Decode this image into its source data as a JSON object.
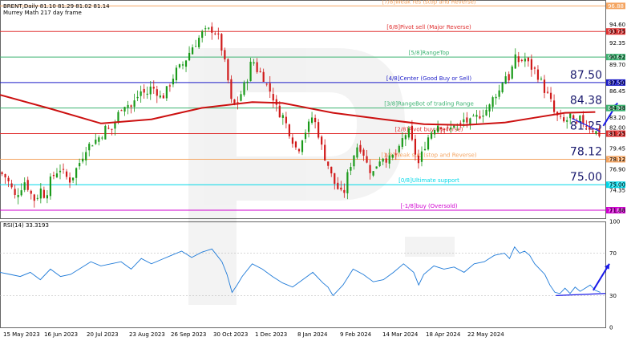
{
  "header": {
    "symbol_line": "BRENT,Daily  81.10 81.29 81.02 81.14",
    "indicator_line": "Murrey Math 217 day frame"
  },
  "rsi": {
    "label": "RSI(14) 33.3193",
    "levels": [
      70,
      30
    ],
    "level_labels": [
      "100",
      "70",
      "30",
      "0"
    ]
  },
  "dates": [
    "15 May 2023",
    "16 Jun 2023",
    "20 Jul 2023",
    "23 Aug 2023",
    "26 Sep 2023",
    "30 Oct 2023",
    "1 Dec 2023",
    "8 Jan 2024",
    "9 Feb 2024",
    "14 Mar 2024",
    "18 Apr 2024",
    "22 May 2024"
  ],
  "price_ticks": [
    "94.60",
    "93.75",
    "92.35",
    "90.62",
    "89.70",
    "87.50",
    "86.45",
    "84.38",
    "83.20",
    "82.00",
    "81.25",
    "79.45",
    "78.12",
    "76.90",
    "75.00",
    "74.35",
    "71.88"
  ],
  "murrey_levels": [
    {
      "price": 96.88,
      "label": "[7/8]Weak res (stop and Reverse)",
      "color": "#f4a460"
    },
    {
      "price": 93.75,
      "label": "[6/8]Pivot sell (Major Reverse)",
      "color": "#e03030"
    },
    {
      "price": 90.62,
      "label": "[5/8]RangeTop",
      "color": "#3cb371"
    },
    {
      "price": 87.5,
      "label": "[4/8]Center (Good Buy or Sell)",
      "color": "#1c1cc8",
      "big": "87.50"
    },
    {
      "price": 84.38,
      "label": "[3/8]RangeBot of trading Range",
      "color": "#3cb371",
      "big": "84.38"
    },
    {
      "price": 81.25,
      "label": "[2/8]Pivot buy (Reverse)",
      "color": "#e03030",
      "big": "81.25"
    },
    {
      "price": 78.12,
      "label": "[1/8]Weak sup (stop and Reverse)",
      "color": "#f4a460",
      "big": "78.12"
    },
    {
      "price": 75.0,
      "label": "[0/8]Ultimate support",
      "color": "#00d8e8",
      "big": "75.00"
    },
    {
      "price": 71.88,
      "label": "[-1/8]buy (Oversold)",
      "color": "#d000d0"
    }
  ],
  "chart_data": {
    "type": "candlestick",
    "symbol": "BRENT",
    "timeframe": "Daily",
    "ohlc_last": {
      "open": 81.1,
      "high": 81.29,
      "low": 81.02,
      "close": 81.14
    },
    "ylim": [
      70.9,
      97.6
    ],
    "x_labels": [
      "15 May 2023",
      "16 Jun 2023",
      "20 Jul 2023",
      "23 Aug 2023",
      "26 Sep 2023",
      "30 Oct 2023",
      "1 Dec 2023",
      "8 Jan 2024",
      "9 Feb 2024",
      "14 Mar 2024",
      "18 Apr 2024",
      "22 May 2024"
    ],
    "close_path": [
      [
        0,
        76.5
      ],
      [
        5,
        76.0
      ],
      [
        10,
        75.0
      ],
      [
        15,
        73.5
      ],
      [
        20,
        74.5
      ],
      [
        25,
        75.5
      ],
      [
        30,
        74.0
      ],
      [
        35,
        73.0
      ],
      [
        40,
        74.5
      ],
      [
        45,
        73.5
      ],
      [
        50,
        75.5
      ],
      [
        55,
        76.5
      ],
      [
        60,
        77.0
      ],
      [
        65,
        76.0
      ],
      [
        70,
        75.5
      ],
      [
        75,
        76.8
      ],
      [
        80,
        78.0
      ],
      [
        85,
        79.5
      ],
      [
        90,
        80.0
      ],
      [
        95,
        80.5
      ],
      [
        100,
        81.0
      ],
      [
        105,
        82.0
      ],
      [
        110,
        81.5
      ],
      [
        115,
        83.0
      ],
      [
        120,
        84.5
      ],
      [
        125,
        85.0
      ],
      [
        130,
        84.5
      ],
      [
        135,
        85.5
      ],
      [
        140,
        86.5
      ],
      [
        145,
        86.0
      ],
      [
        150,
        87.0
      ],
      [
        155,
        86.5
      ],
      [
        160,
        85.5
      ],
      [
        165,
        86.5
      ],
      [
        170,
        87.8
      ],
      [
        175,
        89.0
      ],
      [
        180,
        89.5
      ],
      [
        185,
        90.5
      ],
      [
        190,
        91.8
      ],
      [
        195,
        92.5
      ],
      [
        200,
        93.5
      ],
      [
        205,
        93.8
      ],
      [
        210,
        94.0
      ],
      [
        215,
        93.5
      ],
      [
        220,
        91.5
      ],
      [
        225,
        88.5
      ],
      [
        230,
        84.5
      ],
      [
        235,
        85.0
      ],
      [
        240,
        86.5
      ],
      [
        245,
        88.0
      ],
      [
        250,
        90.5
      ],
      [
        255,
        89.0
      ],
      [
        260,
        88.5
      ],
      [
        265,
        87.0
      ],
      [
        270,
        86.0
      ],
      [
        275,
        84.0
      ],
      [
        280,
        83.5
      ],
      [
        285,
        82.0
      ],
      [
        290,
        80.5
      ],
      [
        295,
        79.0
      ],
      [
        300,
        81.0
      ],
      [
        305,
        82.0
      ],
      [
        310,
        83.5
      ],
      [
        315,
        81.5
      ],
      [
        320,
        79.0
      ],
      [
        325,
        77.5
      ],
      [
        330,
        75.5
      ],
      [
        335,
        74.5
      ],
      [
        340,
        73.5
      ],
      [
        345,
        76.5
      ],
      [
        350,
        78.5
      ],
      [
        355,
        80.0
      ],
      [
        360,
        79.0
      ],
      [
        365,
        77.0
      ],
      [
        370,
        76.5
      ],
      [
        375,
        78.0
      ],
      [
        380,
        78.5
      ],
      [
        385,
        78.0
      ],
      [
        390,
        78.5
      ],
      [
        395,
        79.0
      ],
      [
        400,
        81.0
      ],
      [
        405,
        81.5
      ],
      [
        410,
        79.5
      ],
      [
        415,
        77.5
      ],
      [
        420,
        79.5
      ],
      [
        425,
        81.0
      ],
      [
        430,
        82.0
      ],
      [
        435,
        82.5
      ],
      [
        440,
        82.0
      ],
      [
        445,
        81.5
      ],
      [
        450,
        82.5
      ],
      [
        455,
        82.0
      ],
      [
        460,
        83.0
      ],
      [
        465,
        82.5
      ],
      [
        470,
        83.0
      ],
      [
        475,
        83.5
      ],
      [
        480,
        84.0
      ],
      [
        485,
        84.5
      ],
      [
        490,
        86.0
      ],
      [
        495,
        86.5
      ],
      [
        500,
        88.5
      ],
      [
        505,
        88.0
      ],
      [
        510,
        90.5
      ],
      [
        515,
        90.0
      ],
      [
        520,
        90.5
      ],
      [
        525,
        89.5
      ],
      [
        530,
        89.0
      ],
      [
        535,
        88.0
      ],
      [
        540,
        86.5
      ],
      [
        545,
        85.5
      ],
      [
        550,
        83.5
      ],
      [
        555,
        83.0
      ],
      [
        560,
        82.5
      ],
      [
        565,
        83.5
      ],
      [
        570,
        82.0
      ],
      [
        575,
        83.0
      ],
      [
        580,
        82.5
      ],
      [
        585,
        82.0
      ],
      [
        590,
        81.5
      ],
      [
        595,
        81.1
      ]
    ],
    "ma_path": [
      [
        0,
        86.0
      ],
      [
        50,
        84.3
      ],
      [
        100,
        82.5
      ],
      [
        150,
        83.0
      ],
      [
        200,
        84.4
      ],
      [
        250,
        85.1
      ],
      [
        280,
        85.0
      ],
      [
        330,
        83.8
      ],
      [
        380,
        83.0
      ],
      [
        420,
        82.4
      ],
      [
        460,
        82.3
      ],
      [
        500,
        82.6
      ],
      [
        530,
        83.2
      ],
      [
        560,
        83.8
      ],
      [
        590,
        83.9
      ]
    ],
    "rsi_path": [
      [
        0,
        52
      ],
      [
        10,
        50
      ],
      [
        20,
        48
      ],
      [
        30,
        52
      ],
      [
        40,
        45
      ],
      [
        50,
        55
      ],
      [
        60,
        48
      ],
      [
        70,
        50
      ],
      [
        80,
        56
      ],
      [
        90,
        62
      ],
      [
        100,
        58
      ],
      [
        110,
        60
      ],
      [
        120,
        62
      ],
      [
        130,
        55
      ],
      [
        140,
        65
      ],
      [
        150,
        60
      ],
      [
        160,
        64
      ],
      [
        170,
        68
      ],
      [
        180,
        72
      ],
      [
        190,
        66
      ],
      [
        200,
        71
      ],
      [
        210,
        74
      ],
      [
        220,
        62
      ],
      [
        225,
        50
      ],
      [
        230,
        33
      ],
      [
        235,
        40
      ],
      [
        240,
        48
      ],
      [
        250,
        60
      ],
      [
        260,
        55
      ],
      [
        270,
        48
      ],
      [
        280,
        42
      ],
      [
        290,
        38
      ],
      [
        300,
        45
      ],
      [
        310,
        52
      ],
      [
        320,
        42
      ],
      [
        325,
        38
      ],
      [
        330,
        30
      ],
      [
        340,
        40
      ],
      [
        350,
        55
      ],
      [
        360,
        50
      ],
      [
        370,
        43
      ],
      [
        380,
        45
      ],
      [
        390,
        52
      ],
      [
        400,
        60
      ],
      [
        410,
        52
      ],
      [
        415,
        40
      ],
      [
        420,
        50
      ],
      [
        430,
        58
      ],
      [
        440,
        55
      ],
      [
        450,
        57
      ],
      [
        460,
        52
      ],
      [
        470,
        60
      ],
      [
        480,
        62
      ],
      [
        490,
        68
      ],
      [
        500,
        70
      ],
      [
        505,
        65
      ],
      [
        510,
        76
      ],
      [
        515,
        70
      ],
      [
        520,
        72
      ],
      [
        525,
        68
      ],
      [
        530,
        60
      ],
      [
        535,
        55
      ],
      [
        540,
        50
      ],
      [
        545,
        40
      ],
      [
        550,
        33
      ],
      [
        555,
        32
      ],
      [
        560,
        37
      ],
      [
        565,
        32
      ],
      [
        570,
        38
      ],
      [
        575,
        34
      ],
      [
        580,
        37
      ],
      [
        585,
        40
      ],
      [
        590,
        35
      ],
      [
        595,
        33
      ]
    ],
    "annotations": [
      {
        "type": "trendline",
        "pane": "price",
        "from": [
          567,
          83.1
        ],
        "to": [
          595,
          81.5
        ],
        "color": "#1a1ae8"
      },
      {
        "type": "arrow",
        "pane": "price",
        "from": [
          598,
          82.2
        ],
        "to": [
          612,
          85.0
        ],
        "color": "#1a1ae8"
      },
      {
        "type": "trendline",
        "pane": "rsi",
        "from": [
          551,
          30
        ],
        "to": [
          600,
          32
        ],
        "color": "#1a1ae8"
      },
      {
        "type": "arrow",
        "pane": "rsi",
        "from": [
          588,
          35
        ],
        "to": [
          604,
          60
        ],
        "color": "#1a1ae8"
      }
    ]
  }
}
